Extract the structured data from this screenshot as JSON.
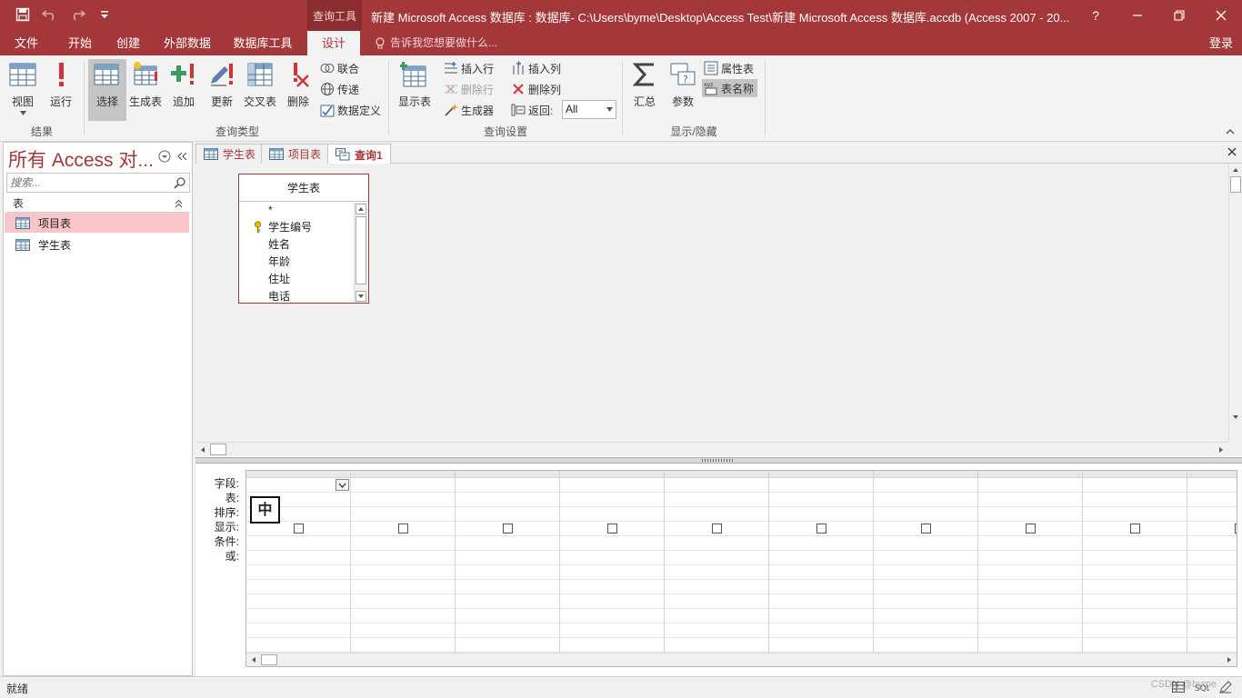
{
  "window": {
    "context_group": "查询工具",
    "title": "新建 Microsoft Access 数据库 : 数据库- C:\\Users\\byme\\Desktop\\Access Test\\新建 Microsoft Access 数据库.accdb (Access 2007 - 20...",
    "help": "?",
    "qat_icons": [
      "save-icon",
      "undo-icon",
      "redo-icon",
      "customize-qat-icon"
    ]
  },
  "ribbon_tabs": [
    {
      "label": "文件"
    },
    {
      "label": "开始"
    },
    {
      "label": "创建"
    },
    {
      "label": "外部数据"
    },
    {
      "label": "数据库工具"
    },
    {
      "label": "设计"
    }
  ],
  "tell_me": "告诉我您想要做什么...",
  "login": "登录",
  "ribbon": {
    "results": {
      "label": "结果",
      "view": "视图",
      "run": "运行"
    },
    "query_type": {
      "label": "查询类型",
      "select": "选择",
      "make_table": "生成表",
      "append": "追加",
      "update": "更新",
      "crosstab": "交叉表",
      "delete": "删除",
      "union": "联合",
      "pass_through": "传递",
      "data_definition": "数据定义"
    },
    "query_setup": {
      "label": "查询设置",
      "show_table": "显示表",
      "insert_rows": "插入行",
      "delete_rows": "删除行",
      "builder": "生成器",
      "insert_columns": "插入列",
      "delete_columns": "删除列",
      "return_label": "返回:",
      "return_value": "All"
    },
    "show_hide": {
      "label": "显示/隐藏",
      "totals": "汇总",
      "parameters": "参数",
      "property_sheet": "属性表",
      "table_names": "表名称"
    }
  },
  "nav": {
    "title": "所有 Access 对...",
    "search_placeholder": "搜索...",
    "section": "表",
    "items": [
      {
        "label": "项目表",
        "selected": true
      },
      {
        "label": "学生表",
        "selected": false
      }
    ]
  },
  "doc_tabs": [
    {
      "label": "学生表"
    },
    {
      "label": "项目表"
    },
    {
      "label": "查询1",
      "active": true
    }
  ],
  "table_box": {
    "title": "学生表",
    "fields": [
      "*",
      "学生编号",
      "姓名",
      "年龄",
      "住址",
      "电话"
    ],
    "primary_key": "学生编号"
  },
  "grid": {
    "row_labels": [
      "字段:",
      "表:",
      "排序:",
      "显示:",
      "条件:",
      "或:"
    ],
    "ime_indicator": "中"
  },
  "status": {
    "text": "就绪",
    "watermark": "CSDN @byme"
  },
  "colors": {
    "accent": "#a4373a",
    "selected_item": "#f8c6c9"
  }
}
